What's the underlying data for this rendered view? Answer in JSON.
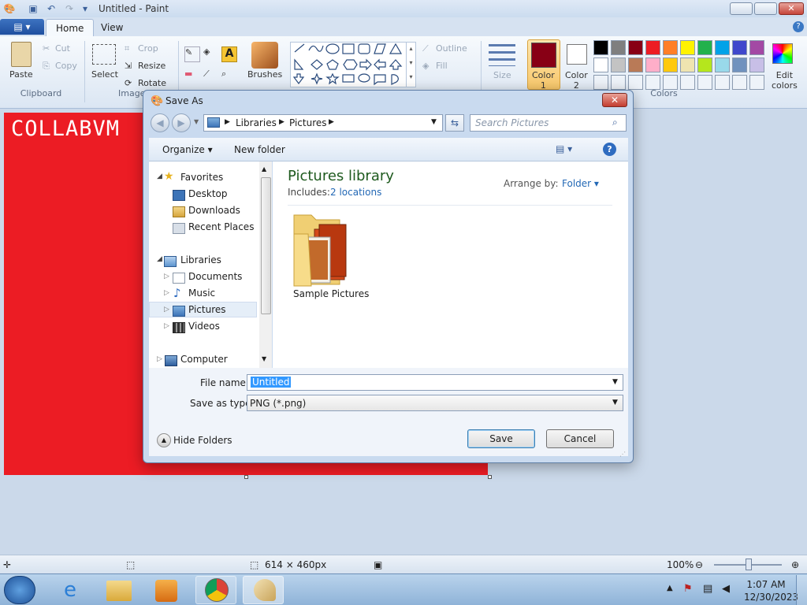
{
  "window": {
    "title": "Untitled - Paint"
  },
  "ribbon": {
    "tabs": [
      "Home",
      "View"
    ],
    "clipboard": {
      "paste": "Paste",
      "cut": "Cut",
      "copy": "Copy",
      "group": "Clipboard"
    },
    "image": {
      "select": "Select",
      "crop": "Crop",
      "resize": "Resize",
      "rotate": "Rotate",
      "group": "Image"
    },
    "tools": {
      "brushes": "Brushes"
    },
    "shapes": {
      "outline": "Outline",
      "fill": "Fill"
    },
    "size": "Size",
    "color1": "Color\n1",
    "color2": "Color\n2",
    "colors_group": "Colors",
    "edit_colors": "Edit\ncolors",
    "palette_row1": [
      "#000000",
      "#7f7f7f",
      "#880015",
      "#ed1c24",
      "#ff7f27",
      "#fff200",
      "#22b14c",
      "#00a2e8",
      "#3f48cc",
      "#a349a4"
    ],
    "palette_row2": [
      "#ffffff",
      "#c3c3c3",
      "#b97a57",
      "#ffaec9",
      "#ffc90e",
      "#efe4b0",
      "#b5e61d",
      "#99d9ea",
      "#7092be",
      "#c8bfe7"
    ],
    "color1_value": "#880015",
    "color2_value": "#ffffff"
  },
  "canvas": {
    "text": "COLLABVM",
    "background": "#ec1c24"
  },
  "status": {
    "size": "614 × 460px",
    "zoom": "100%"
  },
  "taskbar": {
    "time": "1:07 AM",
    "date": "12/30/2023"
  },
  "dialog": {
    "title": "Save As",
    "breadcrumb": [
      "Libraries",
      "Pictures"
    ],
    "search_placeholder": "Search Pictures",
    "toolbar": {
      "organize": "Organize",
      "new_folder": "New folder"
    },
    "nav": {
      "favorites": "Favorites",
      "desktop": "Desktop",
      "downloads": "Downloads",
      "recent": "Recent Places",
      "libraries": "Libraries",
      "documents": "Documents",
      "music": "Music",
      "pictures": "Pictures",
      "videos": "Videos",
      "computer": "Computer"
    },
    "library_title": "Pictures library",
    "includes_label": "Includes:",
    "includes_link": "2 locations",
    "arrange_label": "Arrange by:",
    "arrange_value": "Folder",
    "folder_item": "Sample Pictures",
    "file_name_label": "File name:",
    "file_name_value": "Untitled",
    "save_type_label": "Save as type:",
    "save_type_value": "PNG (*.png)",
    "hide_folders": "Hide Folders",
    "save": "Save",
    "cancel": "Cancel"
  }
}
